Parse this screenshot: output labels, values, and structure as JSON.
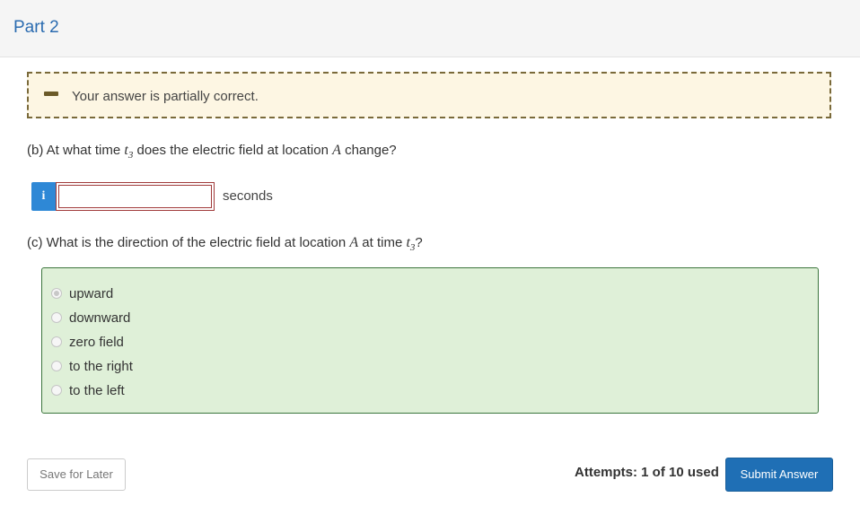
{
  "header": {
    "title": "Part 2"
  },
  "feedback": {
    "message": "Your answer is partially correct.",
    "icon": "minus-icon",
    "border_color": "#7a6a3a",
    "background": "#fdf6e3"
  },
  "question_b": {
    "prefix": "(b) At what time ",
    "variable": "t",
    "subscript": "3",
    "suffix": " does the electric field at location ",
    "location": "A",
    "end": " change?",
    "input_value": "",
    "units": "seconds",
    "info_icon": "info-icon"
  },
  "question_c": {
    "prefix": "(c) What is the direction of the electric field at location ",
    "location": "A",
    "middle": " at time ",
    "variable": "t",
    "subscript": "3",
    "end": "?",
    "options": [
      "upward",
      "downward",
      "zero field",
      "to the right",
      "to the left"
    ],
    "selected": "upward"
  },
  "footer": {
    "save_label": "Save for Later",
    "attempts": "Attempts: 1 of 10 used",
    "submit_label": "Submit Answer"
  },
  "colors": {
    "accent": "#1f6fb5",
    "correct_bg": "#dff0d8",
    "correct_border": "#3c763d",
    "title": "#2a6bb0"
  }
}
